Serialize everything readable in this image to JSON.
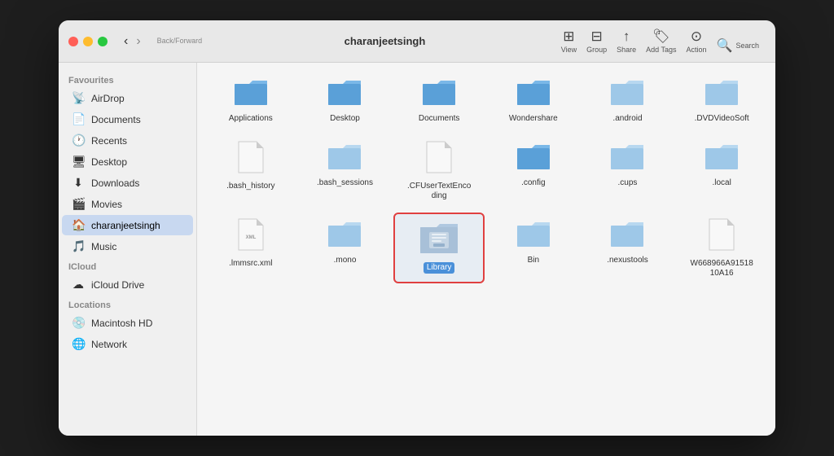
{
  "window": {
    "title": "charanjeetsingh"
  },
  "traffic_lights": {
    "close": "close",
    "minimize": "minimize",
    "maximize": "maximize"
  },
  "toolbar": {
    "back_label": "‹",
    "forward_label": "›",
    "nav_label": "Back/Forward",
    "view_label": "View",
    "group_label": "Group",
    "share_label": "Share",
    "add_tags_label": "Add Tags",
    "action_label": "Action",
    "search_label": "Search"
  },
  "sidebar": {
    "favourites_label": "Favourites",
    "icloud_label": "iCloud",
    "locations_label": "Locations",
    "items": [
      {
        "id": "airdrop",
        "label": "AirDrop",
        "icon": "📡"
      },
      {
        "id": "documents",
        "label": "Documents",
        "icon": "📄"
      },
      {
        "id": "recents",
        "label": "Recents",
        "icon": "🕐"
      },
      {
        "id": "desktop",
        "label": "Desktop",
        "icon": "🖥"
      },
      {
        "id": "downloads",
        "label": "Downloads",
        "icon": "⬇"
      },
      {
        "id": "movies",
        "label": "Movies",
        "icon": "🎬"
      },
      {
        "id": "charanjeetsingh",
        "label": "charanjeetsingh",
        "icon": "🏠"
      },
      {
        "id": "music",
        "label": "Music",
        "icon": "🎵"
      },
      {
        "id": "icloud-drive",
        "label": "iCloud Drive",
        "icon": "☁"
      },
      {
        "id": "macintosh-hd",
        "label": "Macintosh HD",
        "icon": "💿"
      },
      {
        "id": "network",
        "label": "Network",
        "icon": "🌐"
      }
    ]
  },
  "grid_items": [
    {
      "id": "applications",
      "label": "Applications",
      "type": "folder"
    },
    {
      "id": "desktop",
      "label": "Desktop",
      "type": "folder"
    },
    {
      "id": "documents",
      "label": "Documents",
      "type": "folder"
    },
    {
      "id": "wondershare",
      "label": "Wondershare",
      "type": "folder"
    },
    {
      "id": "android",
      "label": ".android",
      "type": "folder-light"
    },
    {
      "id": "dvdvideosoft",
      "label": ".DVDVideoSoft",
      "type": "folder-light"
    },
    {
      "id": "bash_history",
      "label": ".bash_history",
      "type": "doc"
    },
    {
      "id": "bash_sessions",
      "label": ".bash_sessions",
      "type": "folder-light"
    },
    {
      "id": "cfusertextencoding",
      "label": ".CFUserTextEncoding",
      "type": "doc"
    },
    {
      "id": "config",
      "label": ".config",
      "type": "folder"
    },
    {
      "id": "cups",
      "label": ".cups",
      "type": "folder-light"
    },
    {
      "id": "local",
      "label": ".local",
      "type": "folder-light"
    },
    {
      "id": "lmmsrc",
      "label": ".lmmsrc.xml",
      "type": "doc-xml"
    },
    {
      "id": "mono",
      "label": ".mono",
      "type": "folder-light"
    },
    {
      "id": "library",
      "label": "Library",
      "type": "library",
      "selected": true
    },
    {
      "id": "bin",
      "label": "Bin",
      "type": "folder-light"
    },
    {
      "id": "nexustools",
      "label": ".nexustools",
      "type": "folder-light"
    },
    {
      "id": "w668",
      "label": "W668966A91518 10A16",
      "type": "doc"
    }
  ]
}
